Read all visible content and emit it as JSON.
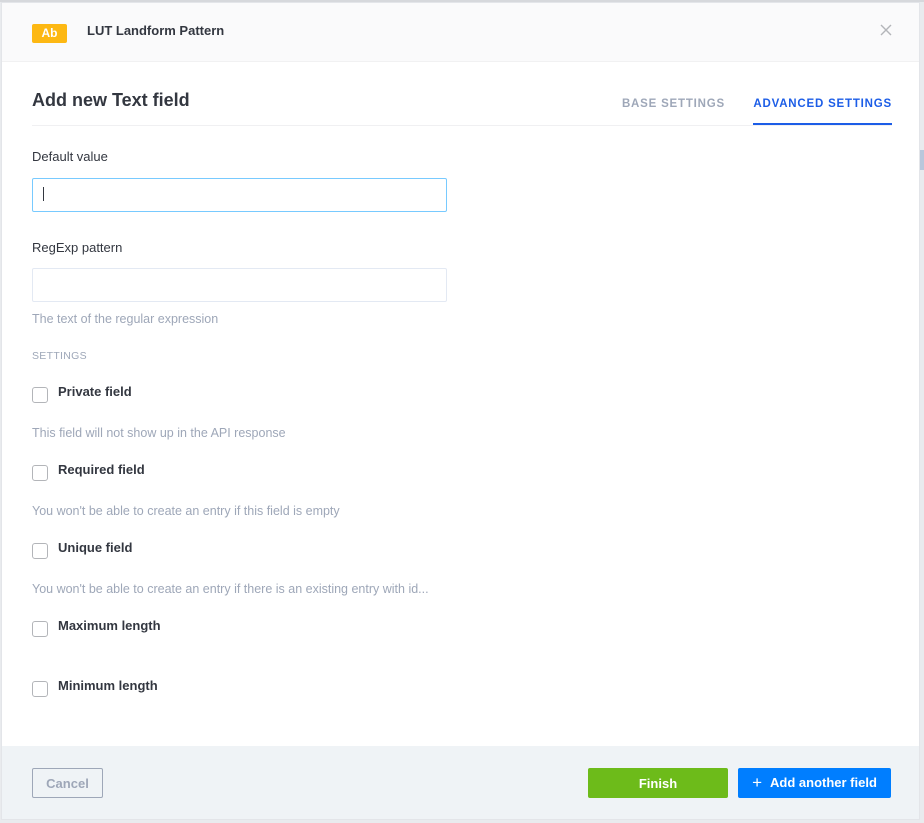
{
  "header": {
    "badge": "Ab",
    "title": "LUT Landform Pattern",
    "close_icon": "close-icon"
  },
  "modal": {
    "title": "Add new Text field",
    "tabs": [
      {
        "label": "BASE SETTINGS",
        "active": false
      },
      {
        "label": "ADVANCED SETTINGS",
        "active": true
      }
    ]
  },
  "fields": {
    "default_value": {
      "label": "Default value",
      "value": "",
      "placeholder": ""
    },
    "regexp": {
      "label": "RegExp pattern",
      "value": "",
      "placeholder": "",
      "help": "The text of the regular expression"
    }
  },
  "settings": {
    "section_title": "SETTINGS",
    "items": [
      {
        "label": "Private field",
        "checked": false,
        "help": "This field will not show up in the API response"
      },
      {
        "label": "Required field",
        "checked": false,
        "help": "You won't be able to create an entry if this field is empty"
      },
      {
        "label": "Unique field",
        "checked": false,
        "help": "You won't be able to create an entry if there is an existing entry with id..."
      },
      {
        "label": "Maximum length",
        "checked": false,
        "help": ""
      },
      {
        "label": "Minimum length",
        "checked": false,
        "help": ""
      }
    ]
  },
  "footer": {
    "cancel_label": "Cancel",
    "finish_label": "Finish",
    "add_label": "Add another field",
    "add_icon": "plus-icon"
  },
  "colors": {
    "badge": "#fdb813",
    "accent": "#1c5de7",
    "finish": "#6dbb1a",
    "add": "#007eff",
    "muted": "#9ea7b8"
  }
}
